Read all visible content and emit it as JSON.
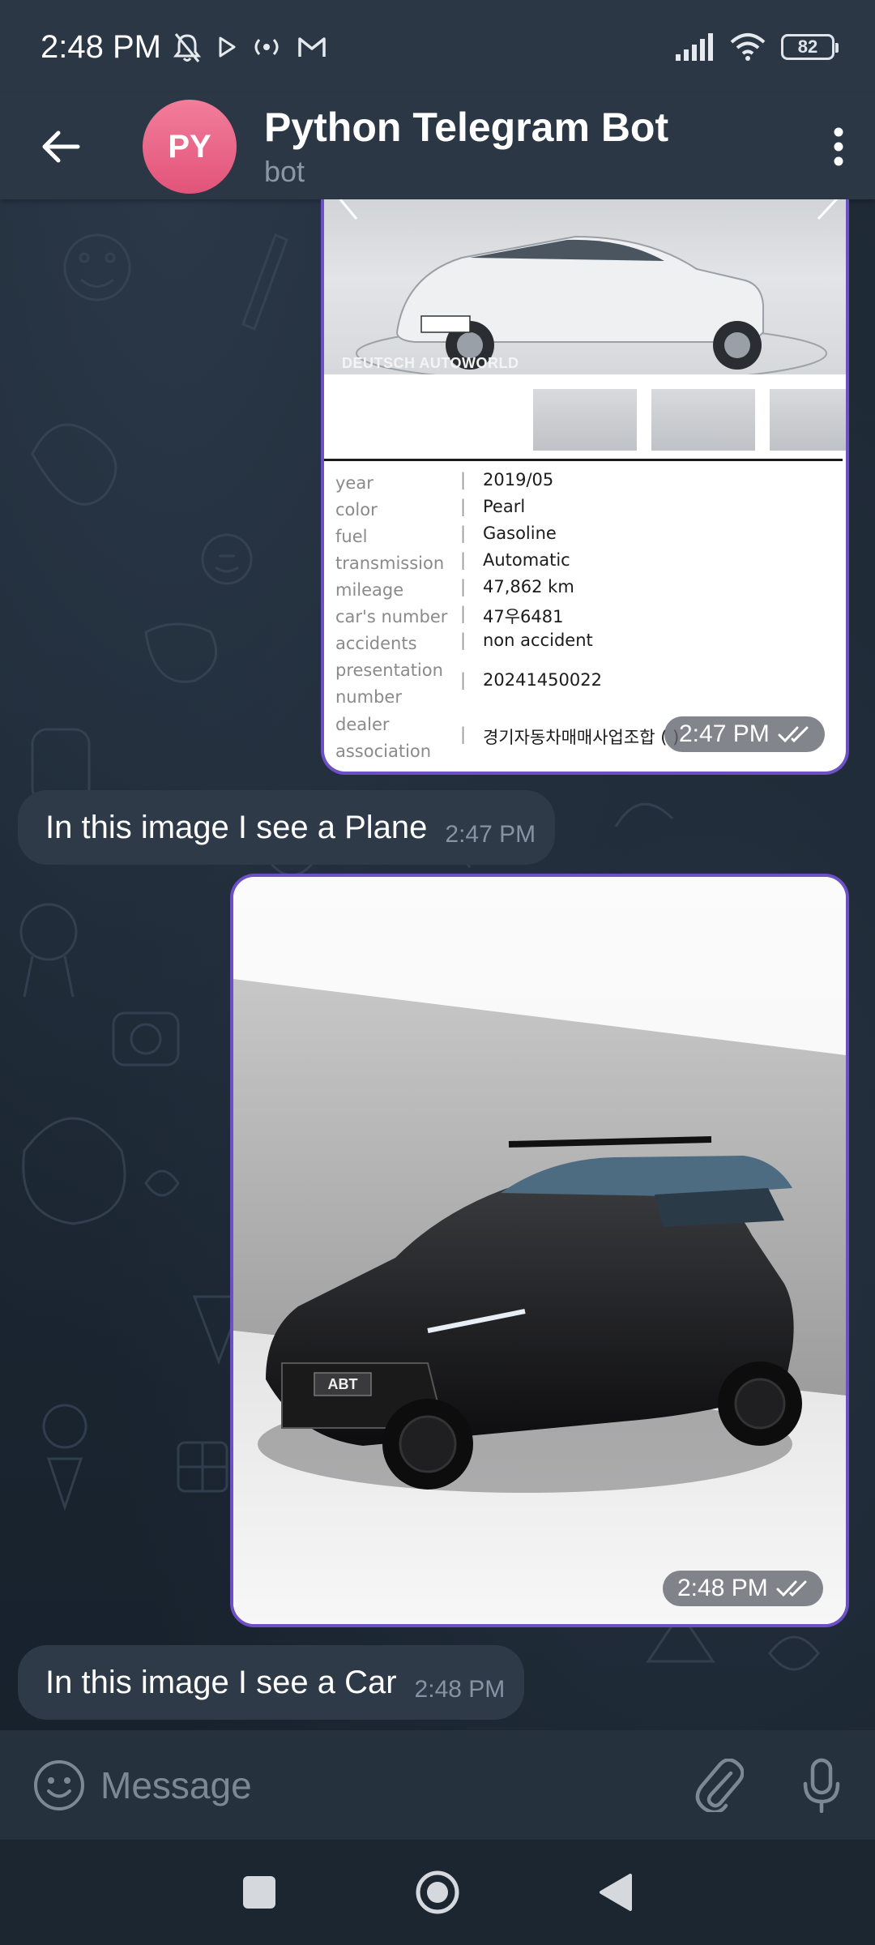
{
  "status_bar": {
    "time": "2:48 PM",
    "battery": "82"
  },
  "header": {
    "avatar_initials": "PY",
    "title": "Python Telegram Bot",
    "subtitle": "bot"
  },
  "messages": [
    {
      "type": "car-listing-image",
      "watermark": "DEUTSCH AUTOWORLD",
      "plate": "47우 6481",
      "specs": [
        {
          "key": "year",
          "value": "2019/05"
        },
        {
          "key": "color",
          "value": "Pearl"
        },
        {
          "key": "fuel",
          "value": "Gasoline"
        },
        {
          "key": "transmission",
          "value": "Automatic"
        },
        {
          "key": "mileage",
          "value": "47,862 km"
        },
        {
          "key": "car's number",
          "value": "47우6481"
        },
        {
          "key": "accidents",
          "value": "non accident"
        },
        {
          "key": "presentation number",
          "value": "20241450022"
        },
        {
          "key": "dealer association",
          "value": "경기자동차매매사업조합 ( )"
        }
      ],
      "time": "2:47 PM"
    },
    {
      "type": "incoming-text",
      "text": "In this image I see a Plane",
      "time": "2:47 PM"
    },
    {
      "type": "photo",
      "badge": "ABT",
      "time": "2:48 PM"
    },
    {
      "type": "incoming-text",
      "text": "In this image I see a Car",
      "time": "2:48 PM"
    }
  ],
  "input": {
    "placeholder": "Message"
  },
  "colors": {
    "header_bg": "#2b3745",
    "incoming_bubble": "#2e3a48",
    "outgoing_border": "#6d4fc6",
    "avatar": "#e96386"
  }
}
